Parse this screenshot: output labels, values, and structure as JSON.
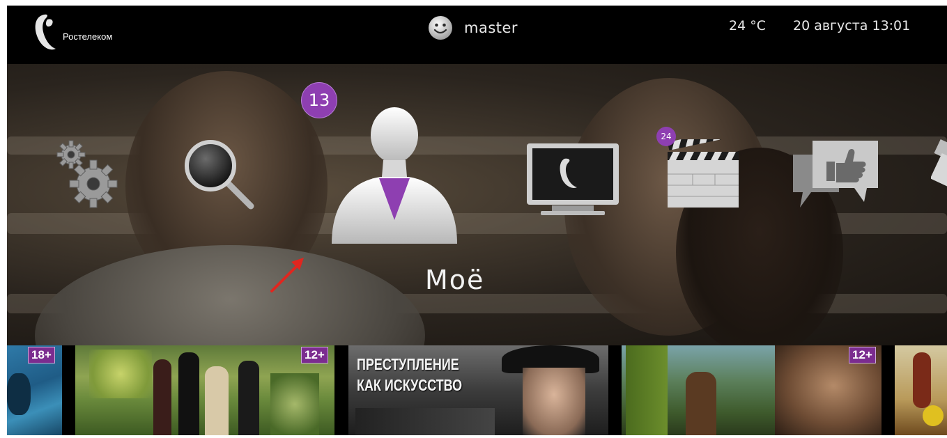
{
  "header": {
    "logo_text": "Ростелеком",
    "username": "master",
    "temperature": "24 °C",
    "datetime": "20 августа 13:01"
  },
  "menu": {
    "focused_label": "Моё",
    "items": [
      {
        "icon": "gears-icon"
      },
      {
        "icon": "magnifier-icon"
      },
      {
        "icon": "my-profile-icon",
        "badge": "13",
        "focused": true
      },
      {
        "icon": "tv-icon"
      },
      {
        "icon": "clapperboard-icon",
        "badge": "24"
      },
      {
        "icon": "social-like-icon"
      },
      {
        "icon": "usb-icon"
      }
    ]
  },
  "posters": [
    {
      "rating": "18+",
      "title": ""
    },
    {
      "rating": "12+",
      "title": ""
    },
    {
      "rating": "",
      "title_line1": "ПРЕСТУПЛЕНИЕ",
      "title_line2": "КАК ИСКУССТВО"
    },
    {
      "rating": "12+",
      "title": ""
    },
    {
      "rating": "",
      "title": ""
    }
  ],
  "colors": {
    "accent": "#8e3fb1",
    "background": "#000000",
    "annotation_arrow": "#e0261f"
  }
}
